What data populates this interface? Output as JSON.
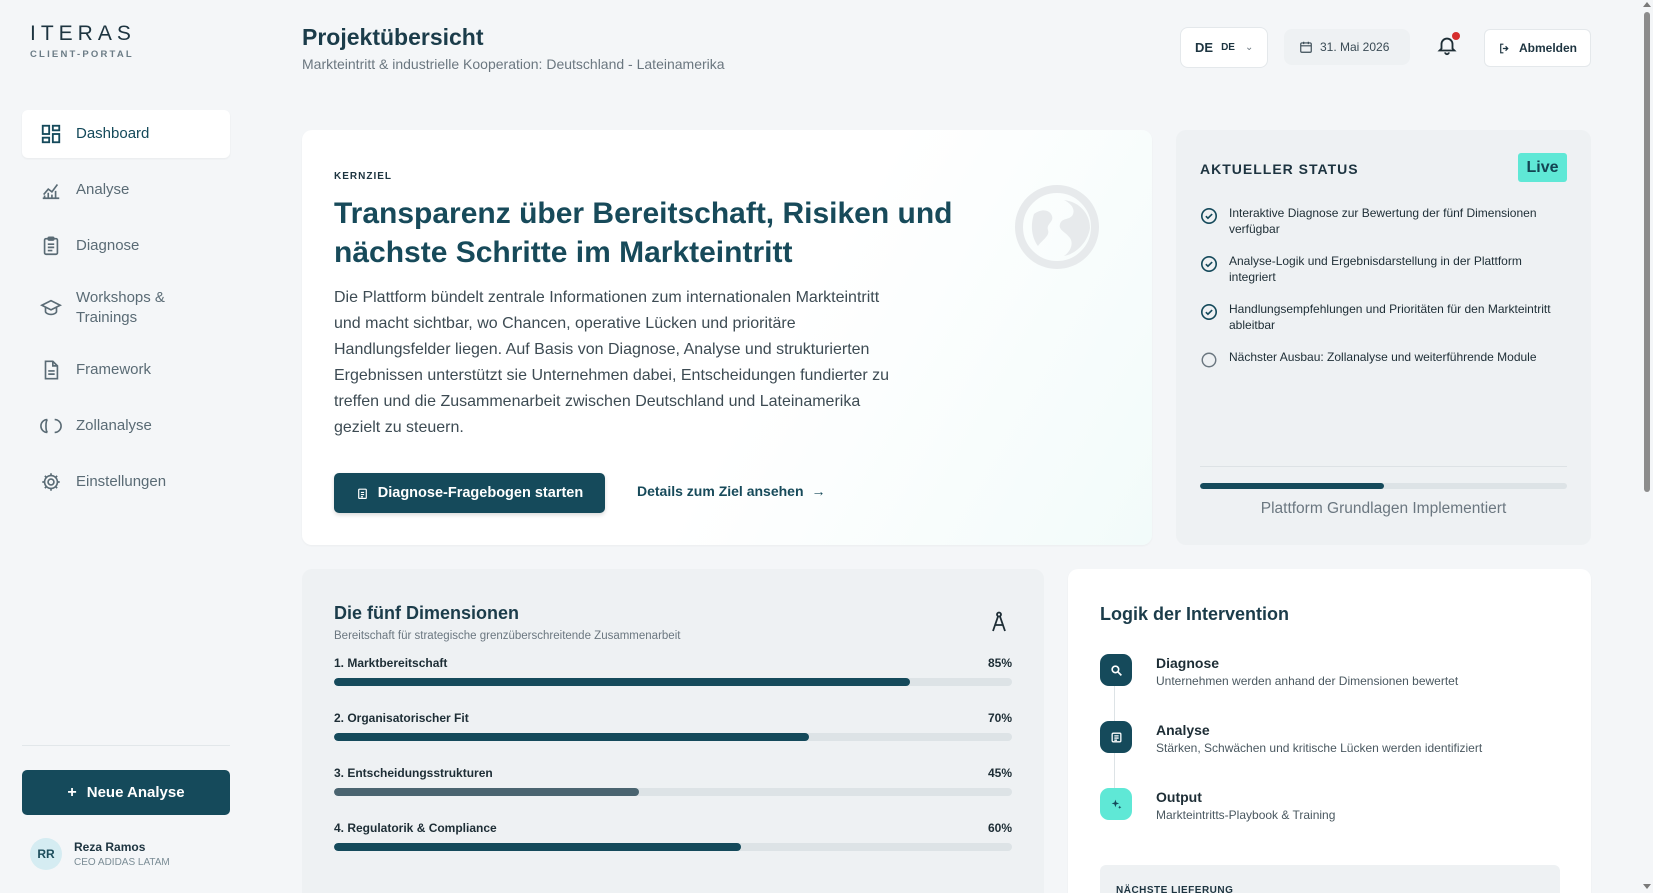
{
  "brand": {
    "name": "ITERAS",
    "sub": "CLIENT-PORTAL"
  },
  "sidebar": {
    "items": [
      {
        "label": "Dashboard",
        "icon": "dashboard-icon",
        "active": true
      },
      {
        "label": "Analyse",
        "icon": "chart-icon"
      },
      {
        "label": "Diagnose",
        "icon": "clipboard-icon"
      },
      {
        "label": "Workshops & Trainings",
        "icon": "graduation-cap-icon"
      },
      {
        "label": "Framework",
        "icon": "document-icon"
      },
      {
        "label": "Zollanalyse",
        "icon": "loop-icon"
      },
      {
        "label": "Einstellungen",
        "icon": "gear-icon"
      }
    ],
    "new_button": "Neue Analyse",
    "user": {
      "initials": "RR",
      "name": "Reza Ramos",
      "role": "CEO ADIDAS LATAM"
    }
  },
  "header": {
    "title": "Projektübersicht",
    "subtitle": "Markteintritt & industrielle Kooperation: Deutschland - Lateinamerika",
    "lang_primary": "DE",
    "lang_secondary": "DE",
    "date": "31. Mai 2026",
    "logout": "Abmelden"
  },
  "hero": {
    "kicker": "KERNZIEL",
    "title": "Transparenz über Bereitschaft, Risiken und nächste Schritte im Markteintritt",
    "text": "Die Plattform bündelt zentrale Informationen zum internationalen Markteintritt und macht sichtbar, wo Chancen, operative Lücken und prioritäre Handlungsfelder liegen. Auf Basis von Diagnose, Analyse und strukturierten Ergebnissen unterstützt sie Unternehmen dabei, Entscheidungen fundierter zu treffen und die Zusammenarbeit zwischen Deutschland und Lateinamerika gezielt zu steuern.",
    "primary_button": "Diagnose-Fragebogen starten",
    "link": "Details zum Ziel ansehen"
  },
  "status": {
    "title": "AKTUELLER STATUS",
    "badge": "Live",
    "items": [
      {
        "text": "Interaktive Diagnose zur Bewertung der fünf Dimensionen verfügbar",
        "done": true
      },
      {
        "text": "Analyse-Logik und Ergebnisdarstellung in der Plattform integriert",
        "done": true
      },
      {
        "text": "Handlungsempfehlungen und Prioritäten für den Markteintritt ableitbar",
        "done": true
      },
      {
        "text": "Nächster Ausbau: Zollanalyse und weiterführende Module",
        "done": false
      }
    ],
    "progress": 0.5,
    "progress_label": "Plattform Grundlagen Implementiert"
  },
  "dimensions": {
    "title": "Die fünf Dimensionen",
    "subtitle": "Bereitschaft für strategische grenzüberschreitende Zusammenarbeit",
    "items": [
      {
        "label": "1. Marktbereitschaft",
        "value_text": "85%",
        "value": 85,
        "color": "#154a5b"
      },
      {
        "label": "2. Organisatorischer Fit",
        "value_text": "70%",
        "value": 70,
        "color": "#154a5b"
      },
      {
        "label": "3. Entscheidungsstrukturen",
        "value_text": "45%",
        "value": 45,
        "color": "#4a6470"
      },
      {
        "label": "4. Regulatorik & Compliance",
        "value_text": "60%",
        "value": 60,
        "color": "#154a5b"
      }
    ]
  },
  "logic": {
    "title": "Logik der Intervention",
    "steps": [
      {
        "title": "Diagnose",
        "desc": "Unternehmen werden anhand der Dimensionen bewertet",
        "icon": "search-icon"
      },
      {
        "title": "Analyse",
        "desc": "Stärken, Schwächen und kritische Lücken werden identifiziert",
        "icon": "report-icon"
      },
      {
        "title": "Output",
        "desc": "Markteintritts-Playbook & Training",
        "icon": "sparkle-icon"
      }
    ],
    "delivery_title": "NÄCHSTE LIEFERUNG"
  },
  "colors": {
    "primary": "#154a5b",
    "accent": "#5fe8d6",
    "alert": "#d62e2e"
  }
}
